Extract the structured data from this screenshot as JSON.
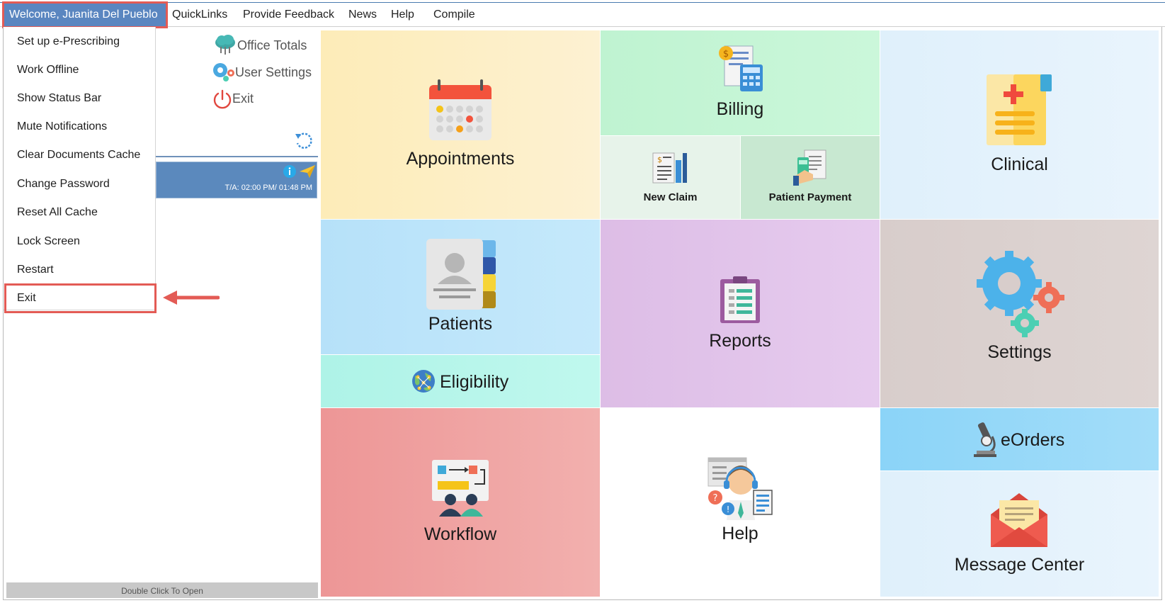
{
  "menubar": {
    "welcome": "Welcome, Juanita Del Pueblo",
    "quicklinks": "QuickLinks",
    "feedback": "Provide Feedback",
    "news": "News",
    "help": "Help",
    "compile": "Compile"
  },
  "dropdown": {
    "items": [
      "Set up e-Prescribing",
      "Work Offline",
      "Show Status Bar",
      "Mute Notifications",
      "Clear Documents Cache",
      "Change Password",
      "Reset All Cache",
      "Lock Screen",
      "Restart",
      "Exit"
    ]
  },
  "left_panel": {
    "office_totals": "Office Totals",
    "user_settings": "User Settings",
    "exit": "Exit",
    "appointment_time": "T/A: 02:00 PM/ 01:48 PM",
    "footer": "Double Click To Open"
  },
  "tiles": {
    "appointments": "Appointments",
    "billing": "Billing",
    "new_claim": "New Claim",
    "patient_payment": "Patient Payment",
    "clinical": "Clinical",
    "patients": "Patients",
    "eligibility": "Eligibility",
    "reports": "Reports",
    "settings": "Settings",
    "workflow": "Workflow",
    "help": "Help",
    "eorders": "eOrders",
    "message_center": "Message Center"
  },
  "colors": {
    "accent": "#5a86c0",
    "highlight": "#e35b55",
    "appointments_bg": "#fdeebe",
    "billing_bg": "#c4f5d5",
    "clinical_bg": "#e3f1fc",
    "patients_bg": "#b9e3fa",
    "eligibility_bg": "#b3f5ea",
    "reports_bg": "#e1c2e8",
    "settings_bg": "#dbd1cf",
    "workflow_bg": "#ee9b9b",
    "eorders_bg": "#8fd6f8"
  }
}
